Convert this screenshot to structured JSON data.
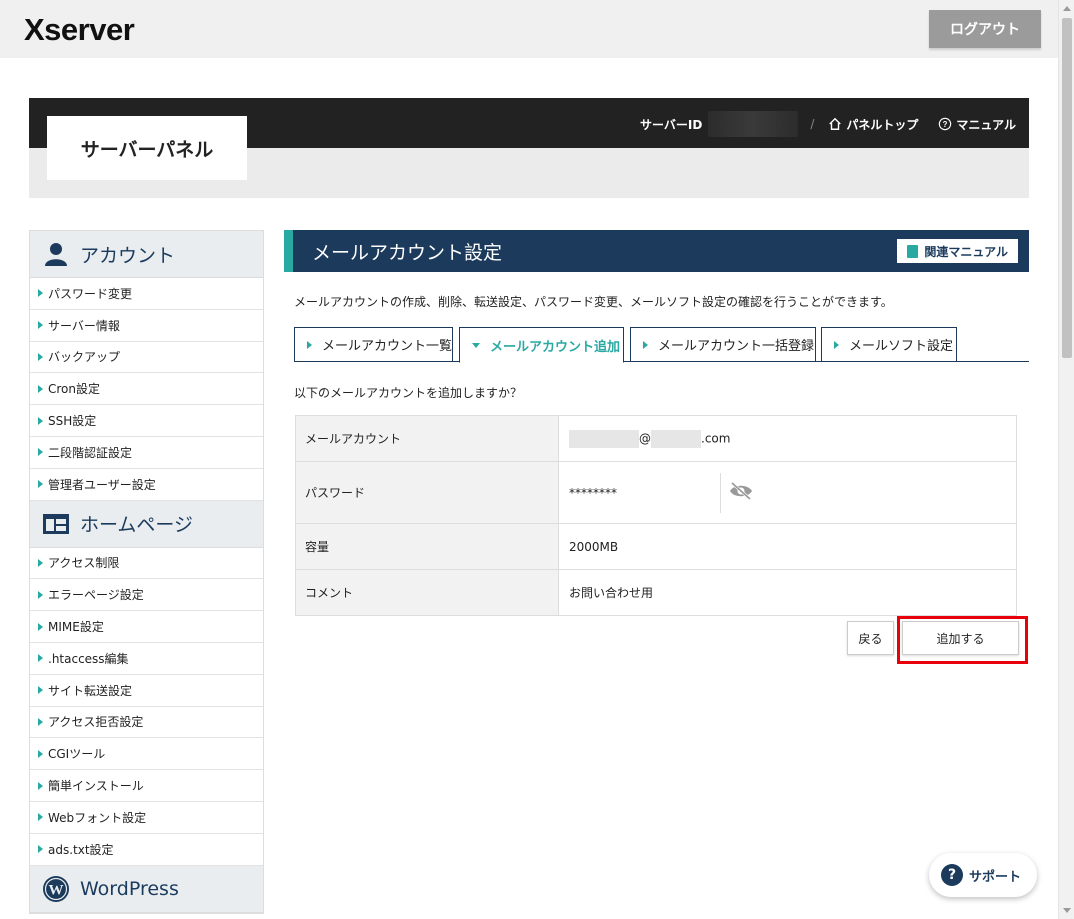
{
  "header": {
    "logo": "Xserver",
    "logout_label": "ログアウト"
  },
  "panel": {
    "title": "サーバーパネル",
    "server_id_label": "サーバーID",
    "separator": "/",
    "panel_top_label": "パネルトップ",
    "manual_label": "マニュアル"
  },
  "sidebar": {
    "account": {
      "title": "アカウント",
      "items": [
        "パスワード変更",
        "サーバー情報",
        "バックアップ",
        "Cron設定",
        "SSH設定",
        "二段階認証設定",
        "管理者ユーザー設定"
      ]
    },
    "homepage": {
      "title": "ホームページ",
      "items": [
        "アクセス制限",
        "エラーページ設定",
        "MIME設定",
        ".htaccess編集",
        "サイト転送設定",
        "アクセス拒否設定",
        "CGIツール",
        "簡単インストール",
        "Webフォント設定",
        "ads.txt設定"
      ]
    },
    "wordpress": {
      "title": "WordPress"
    }
  },
  "main": {
    "title": "メールアカウント設定",
    "related_manual": "関連マニュアル",
    "description": "メールアカウントの作成、削除、転送設定、パスワード変更、メールソフト設定の確認を行うことができます。",
    "tabs": [
      "メールアカウント一覧",
      "メールアカウント追加",
      "メールアカウント一括登録",
      "メールソフト設定"
    ],
    "confirm_text": "以下のメールアカウントを追加しますか？",
    "form": {
      "account_label": "メールアカウント",
      "account_at": "@",
      "account_suffix": ".com",
      "password_label": "パスワード",
      "password_value": "********",
      "capacity_label": "容量",
      "capacity_value": "2000MB",
      "comment_label": "コメント",
      "comment_value": "お問い合わせ用"
    },
    "back_label": "戻る",
    "add_label": "追加する"
  },
  "support_label": "サポート",
  "colors": {
    "navy": "#1b3a5c",
    "teal": "#2aa9a2",
    "highlight": "#e8000b"
  }
}
